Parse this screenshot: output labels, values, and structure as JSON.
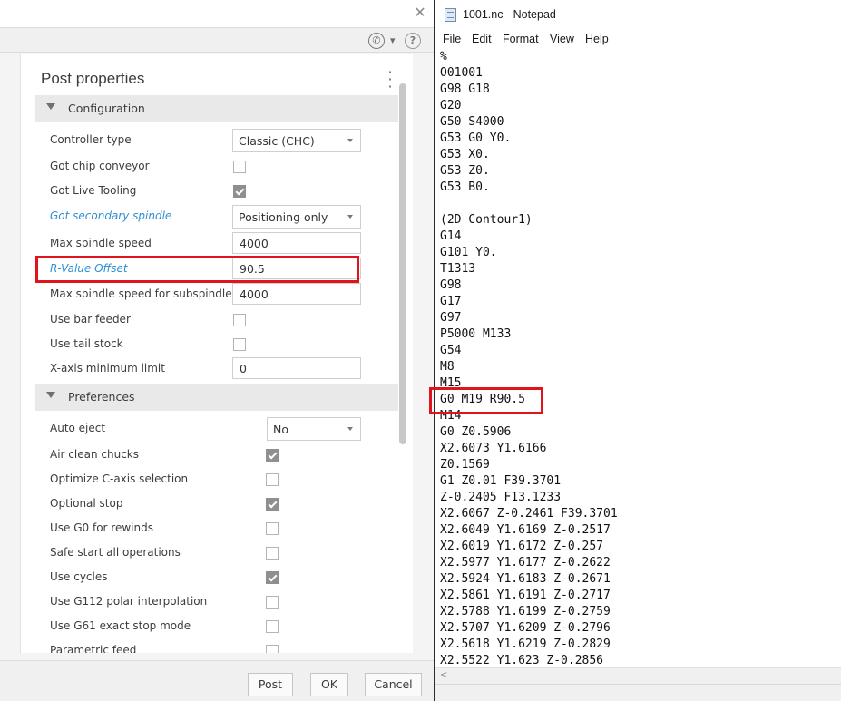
{
  "dialog": {
    "title": "Post properties",
    "sections": {
      "configuration": "Configuration",
      "preferences": "Preferences"
    },
    "configuration": {
      "controller_type": {
        "label": "Controller type",
        "value": "Classic (CHC)"
      },
      "got_chip_conveyor": {
        "label": "Got chip conveyor",
        "checked": false
      },
      "got_live_tooling": {
        "label": "Got Live Tooling",
        "checked": true
      },
      "got_secondary_spindle": {
        "label": "Got secondary spindle",
        "value": "Positioning only"
      },
      "max_spindle_speed": {
        "label": "Max spindle speed",
        "value": "4000"
      },
      "r_value_offset": {
        "label": "R-Value Offset",
        "value": "90.5"
      },
      "max_spindle_speed_sub": {
        "label": "Max spindle speed for subspindle",
        "value": "4000"
      },
      "use_bar_feeder": {
        "label": "Use bar feeder",
        "checked": false
      },
      "use_tail_stock": {
        "label": "Use tail stock",
        "checked": false
      },
      "x_axis_min_limit": {
        "label": "X-axis minimum limit",
        "value": "0"
      }
    },
    "preferences": {
      "auto_eject": {
        "label": "Auto eject",
        "value": "No"
      },
      "items": [
        {
          "label": "Air clean chucks",
          "checked": true
        },
        {
          "label": "Optimize C-axis selection",
          "checked": false
        },
        {
          "label": "Optional stop",
          "checked": true
        },
        {
          "label": "Use G0 for rewinds",
          "checked": false
        },
        {
          "label": "Safe start all operations",
          "checked": false
        },
        {
          "label": "Use cycles",
          "checked": true
        },
        {
          "label": "Use G112 polar interpolation",
          "checked": false
        },
        {
          "label": "Use G61 exact stop mode",
          "checked": false
        },
        {
          "label": "Parametric feed",
          "checked": false
        }
      ]
    },
    "buttons": {
      "post": "Post",
      "ok": "OK",
      "cancel": "Cancel"
    },
    "icons": {
      "close": "close-icon",
      "phone": "phone-icon",
      "help": "help-icon",
      "menu": "kebab-menu-icon"
    },
    "colors": {
      "highlight": "#e0141c",
      "link": "#2f8fd1"
    }
  },
  "notepad": {
    "title": "1001.nc - Notepad",
    "menu": [
      "File",
      "Edit",
      "Format",
      "View",
      "Help"
    ],
    "lines": [
      "%",
      "O01001",
      "G98 G18",
      "G20",
      "G50 S4000",
      "G53 G0 Y0.",
      "G53 X0.",
      "G53 Z0.",
      "G53 B0.",
      "",
      "(2D Contour1)",
      "G14",
      "G101 Y0.",
      "T1313",
      "G98",
      "G17",
      "G97",
      "P5000 M133",
      "G54",
      "M8",
      "M15",
      "G0 M19 R90.5",
      "M14",
      "G0 Z0.5906",
      "X2.6073 Y1.6166",
      "Z0.1569",
      "G1 Z0.01 F39.3701",
      "Z-0.2405 F13.1233",
      "X2.6067 Z-0.2461 F39.3701",
      "X2.6049 Y1.6169 Z-0.2517",
      "X2.6019 Y1.6172 Z-0.257",
      "X2.5977 Y1.6177 Z-0.2622",
      "X2.5924 Y1.6183 Z-0.2671",
      "X2.5861 Y1.6191 Z-0.2717",
      "X2.5788 Y1.6199 Z-0.2759",
      "X2.5707 Y1.6209 Z-0.2796",
      "X2.5618 Y1.6219 Z-0.2829",
      "X2.5522 Y1.623 Z-0.2856"
    ],
    "caret_line": 10,
    "highlight_line": 21,
    "scroll_left": "<"
  }
}
